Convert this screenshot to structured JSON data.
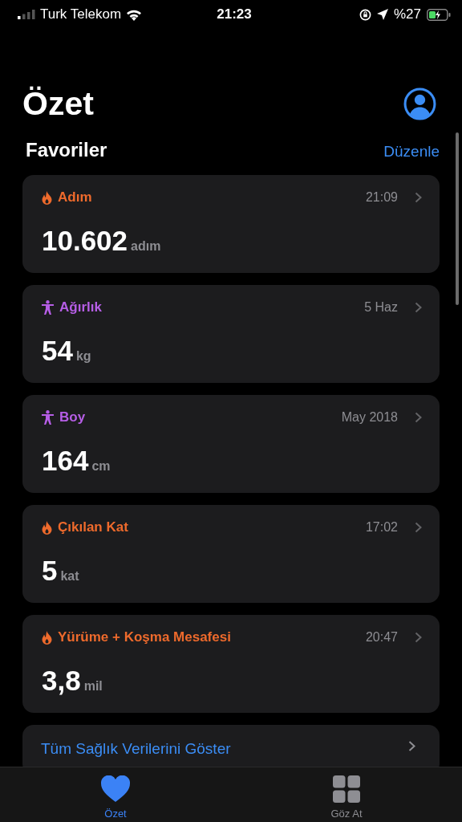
{
  "status_bar": {
    "carrier": "Turk Telekom",
    "time": "21:23",
    "battery": "%27"
  },
  "title": "Özet",
  "favorites": {
    "heading": "Favoriler",
    "edit": "Düzenle"
  },
  "cards": [
    {
      "kind": "flame",
      "name": "Adım",
      "time": "21:09",
      "value": "10.602",
      "unit": "adım"
    },
    {
      "kind": "figure",
      "name": "Ağırlık",
      "time": "5 Haz",
      "value": "54",
      "unit": "kg"
    },
    {
      "kind": "figure",
      "name": "Boy",
      "time": "May 2018",
      "value": "164",
      "unit": "cm"
    },
    {
      "kind": "flame",
      "name": "Çıkılan Kat",
      "time": "17:02",
      "value": "5",
      "unit": "kat"
    },
    {
      "kind": "flame",
      "name": "Yürüme + Koşma Mesafesi",
      "time": "20:47",
      "value": "3,8",
      "unit": "mil"
    }
  ],
  "show_all": "Tüm Sağlık Verilerini Göster",
  "tabs": [
    {
      "kind": "heart",
      "label": "Özet",
      "selected": true
    },
    {
      "kind": "grid",
      "label": "Göz At",
      "selected": false
    }
  ]
}
